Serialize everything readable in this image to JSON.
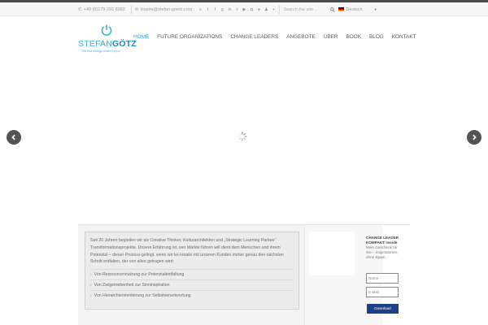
{
  "topbar": {
    "phone": "+49 (0)179 292 8382",
    "email": "inspire@stefan-goetz.com",
    "social_icons": [
      "skype-icon",
      "twitter-icon",
      "facebook-icon",
      "google-plus-icon",
      "linkedin-icon",
      "xing-icon",
      "youtube-icon",
      "instagram-icon",
      "flickr-icon",
      "group-icon",
      "mail-icon"
    ],
    "search_placeholder": "Search the site...",
    "language": "Deutsch"
  },
  "logo": {
    "word_light": "STEFAN",
    "word_bold": "GÖTZ",
    "tagline": "The true change-leader in you"
  },
  "nav": {
    "items": [
      "HOME",
      "FUTURE ORGANIZATIONS",
      "CHANGE LEADERS",
      "ANGEBOTE",
      "ÜBER",
      "BOOK",
      "BLOG",
      "KONTAKT"
    ],
    "active": "HOME"
  },
  "intro": {
    "paragraph": "Seit 20 Jahren begleiten wir als Creative Thinker, Kulturarchitekten und „Strategic Learning Partner“ Transformationsprojekte. Unsere Erfahrung ist, wer Märkte führen will dient dem Menschen und ihrem Potenzial – dieser Prozess gelingt, wenn wir ko-kreativ mit unseren Kunden immer genau den nächsten Schritt entfalten, der von allen getragen wird:",
    "bullets": [
      "Von Ressourcennutzung zur Potenzialentfaltung",
      "Von Zielgetriebenheit zur Sinninspiration",
      "Von Hierarchieorientierung zur Selbstverantwortung"
    ]
  },
  "signup": {
    "title": "CHANGE LEADER KOMPAKT:",
    "title_suffix": "Inside",
    "desc": "Mein Geschenk für Sie – Inspirationen, ohne Spam.",
    "name_placeholder": "Name",
    "email_placeholder": "E-Mail",
    "button": "Download"
  },
  "colors": {
    "accent": "#2aa5d6",
    "logo_blue": "#3bb0d6",
    "button": "#1e3f8a",
    "arrow_bg": "#545454"
  }
}
